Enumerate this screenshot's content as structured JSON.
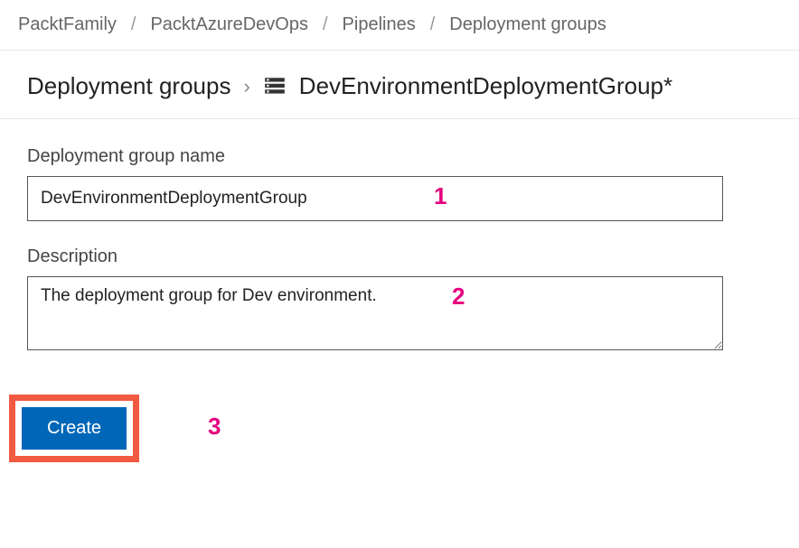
{
  "breadcrumb": {
    "items": [
      "PacktFamily",
      "PacktAzureDevOps",
      "Pipelines",
      "Deployment groups"
    ]
  },
  "page_header": {
    "parent": "Deployment groups",
    "current": "DevEnvironmentDeploymentGroup*"
  },
  "form": {
    "name_label": "Deployment group name",
    "name_value": "DevEnvironmentDeploymentGroup",
    "description_label": "Description",
    "description_value": "The deployment group for Dev environment.",
    "create_label": "Create"
  },
  "annotations": {
    "one": "1",
    "two": "2",
    "three": "3"
  },
  "colors": {
    "annotation": "#e6007e",
    "highlight_border": "#f15a42",
    "primary_button": "#0067b8"
  }
}
